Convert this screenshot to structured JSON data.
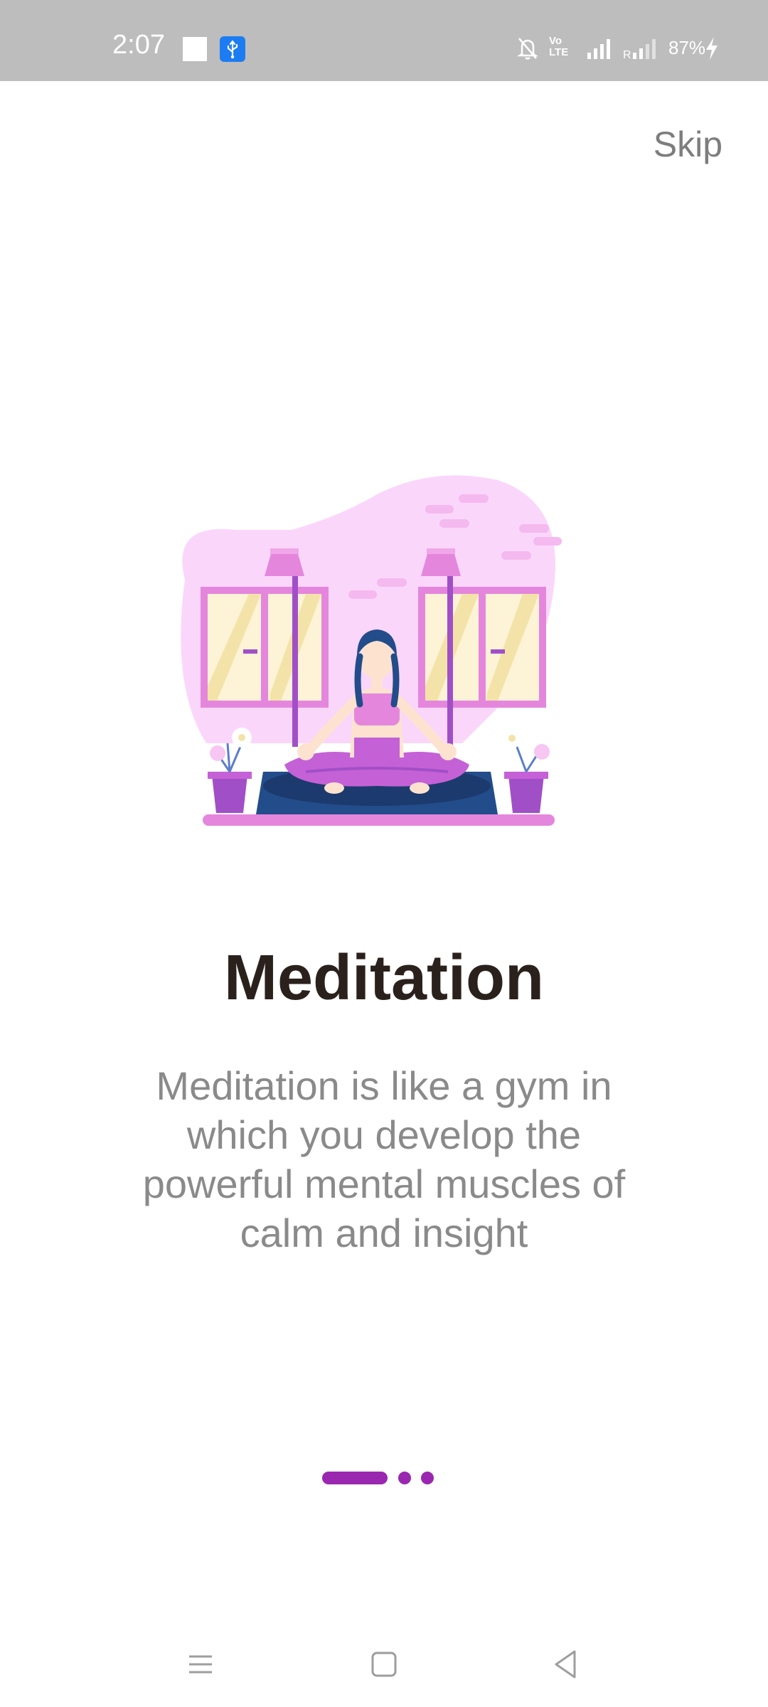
{
  "status_bar": {
    "time": "2:07",
    "battery": "87%"
  },
  "onboarding": {
    "skip_label": "Skip",
    "title": "Meditation",
    "description": "Meditation is like a gym in which you develop the powerful mental muscles of calm and insight",
    "page_index": 1,
    "page_count": 3
  },
  "colors": {
    "accent": "#9a27b0",
    "title": "#2b211c",
    "body_text": "#8a8a8a",
    "status_bar": "#bdbdbd"
  },
  "icons": {
    "notification_square": "square-notification-icon",
    "usb": "usb-debug-icon",
    "mute": "bell-off-icon",
    "volte": "volte-icon",
    "signal_1": "signal-icon",
    "signal_2": "roaming-signal-icon",
    "charging": "charging-bolt-icon",
    "nav_menu": "menu-icon",
    "nav_home": "home-icon",
    "nav_back": "back-icon"
  }
}
